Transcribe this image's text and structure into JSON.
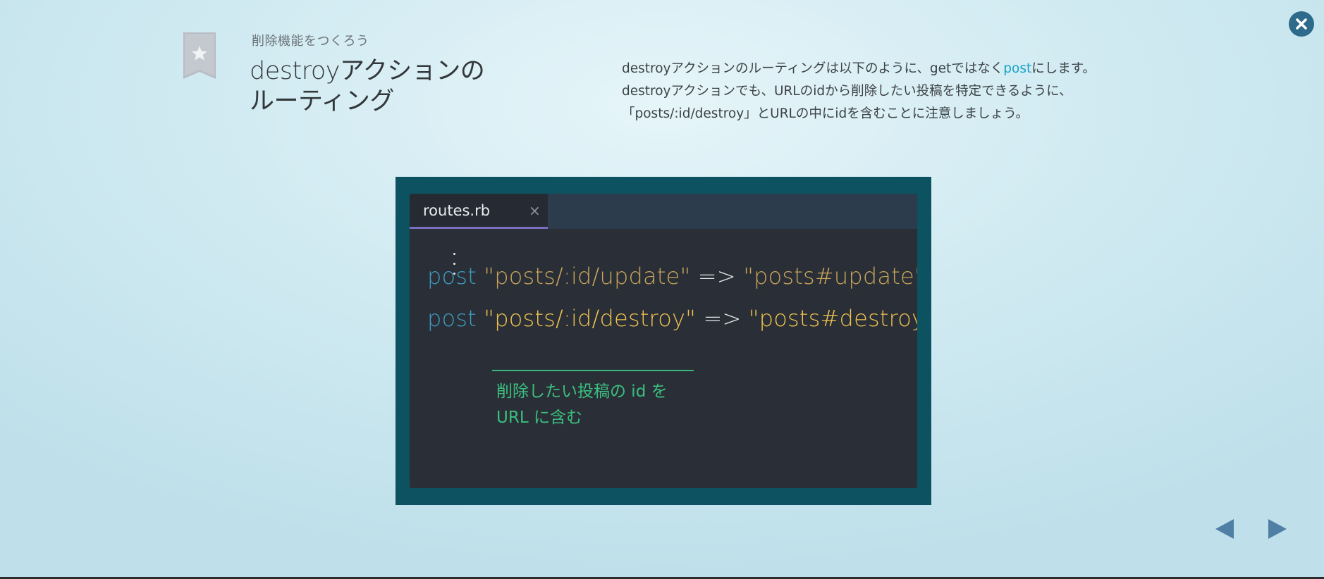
{
  "header": {
    "subtitle": "削除機能をつくろう",
    "title_line1": "destroyアクションの",
    "title_line2": "ルーティング"
  },
  "description": {
    "part1": "destroyアクションのルーティングは以下のように、getではなく",
    "link_text": "post",
    "part2": "にします。destroyアクションでも、URLのidから削除したい投稿を特定できるように、「posts/:id/destroy」とURLの中にidを含むことに注意しましょう。"
  },
  "editor": {
    "tab_label": "routes.rb",
    "tab_close": "×",
    "line1": {
      "keyword": "post",
      "path": "\"posts/:id/update\"",
      "arrow": "=>",
      "target": "\"posts#update\""
    },
    "line2": {
      "keyword": "post",
      "path": "\"posts/:id/destroy\"",
      "arrow": "=>",
      "target": "\"posts#destroy\""
    },
    "annotation_line1": "削除したい投稿の id を",
    "annotation_line2": "URL に含む"
  },
  "icons": {
    "bookmark": "bookmark-star-icon",
    "close": "close-icon",
    "prev": "arrow-left-icon",
    "next": "arrow-right-icon"
  },
  "colors": {
    "link": "#15a3c9",
    "keyword": "#3e9bc0",
    "string": "#f0c34f",
    "annotation": "#3bbf7f",
    "tab_underline": "#7c6fc3",
    "figure_frame": "#0c5260",
    "close_button": "#2e6a8b"
  }
}
